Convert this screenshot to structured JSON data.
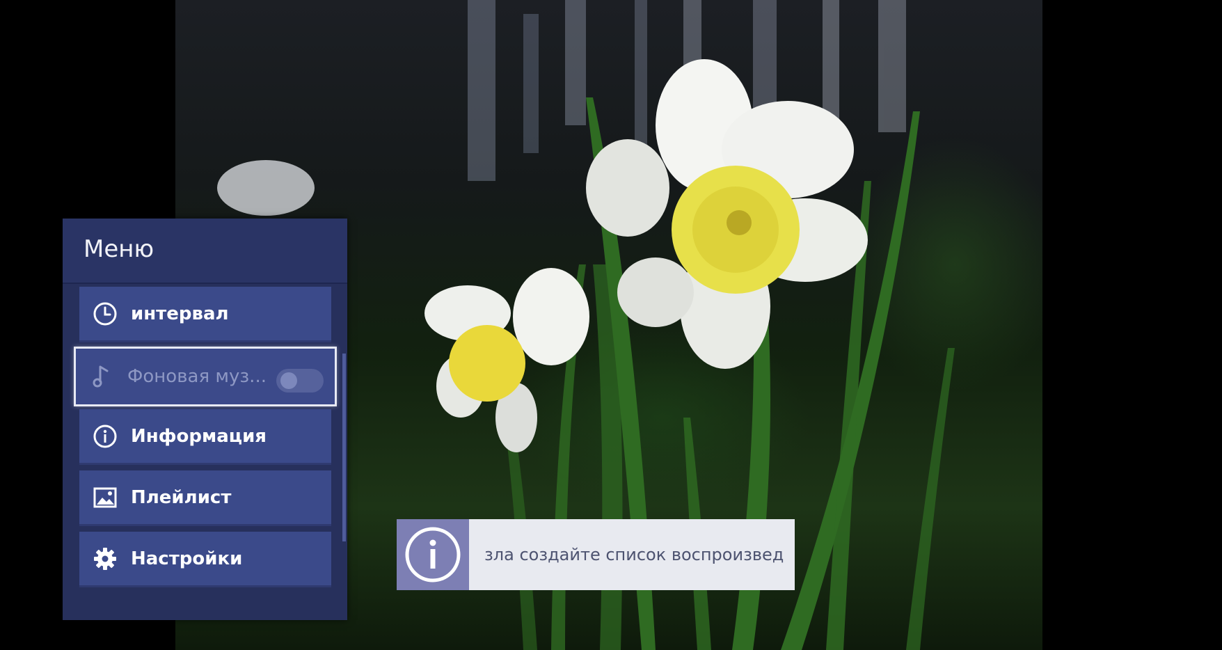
{
  "menu": {
    "title": "Меню",
    "items": [
      {
        "label": "интервал",
        "icon": "clock-icon"
      },
      {
        "label": "Фоновая муз...",
        "icon": "music-note-icon",
        "toggle": "off"
      },
      {
        "label": "Информация",
        "icon": "info-icon"
      },
      {
        "label": "Плейлист",
        "icon": "image-icon"
      },
      {
        "label": "Настройки",
        "icon": "gear-icon"
      }
    ]
  },
  "toast": {
    "icon": "info-icon",
    "text": "зла создайте список воспроизвед"
  },
  "colors": {
    "panel": "#27305c",
    "item": "#3b4a8a",
    "toast_accent": "#7d7fb4"
  }
}
